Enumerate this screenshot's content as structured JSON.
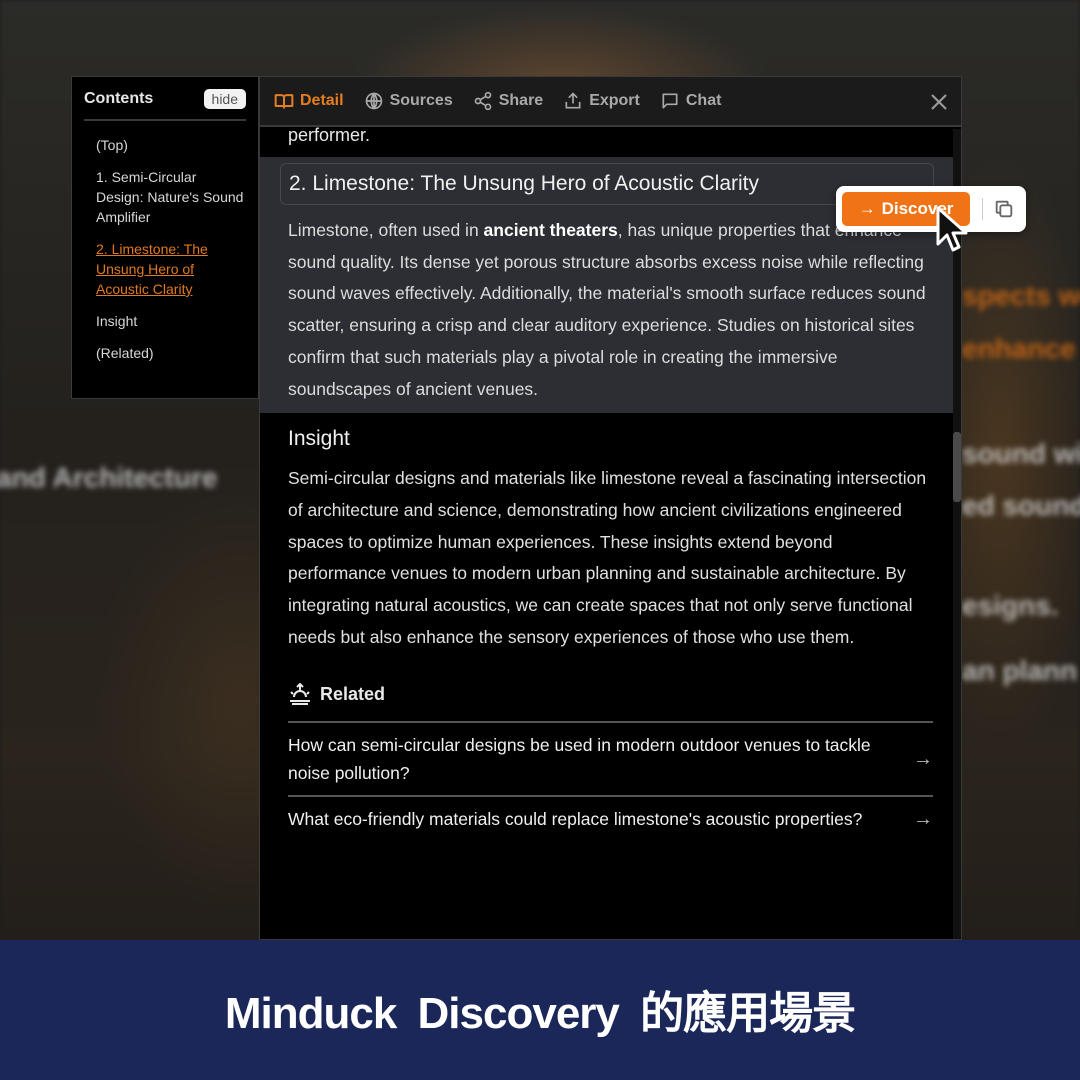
{
  "background": {
    "blurred_texts": [
      {
        "text": "and Architecture",
        "tone": "white"
      },
      {
        "text": "spects wo",
        "tone": "orange"
      },
      {
        "text": "enhance s",
        "tone": "orange"
      },
      {
        "text": "sound wit",
        "tone": "white"
      },
      {
        "text": "ed soundsc",
        "tone": "white"
      },
      {
        "text": "esigns.",
        "tone": "white"
      },
      {
        "text": "an plann",
        "tone": "white"
      }
    ]
  },
  "contents": {
    "title": "Contents",
    "hide_label": "hide",
    "items": [
      {
        "label": "(Top)",
        "active": false
      },
      {
        "label": "1. Semi-Circular Design: Nature's Sound Amplifier",
        "active": false
      },
      {
        "label": "2. Limestone: The Unsung Hero of Acoustic Clarity",
        "active": true
      },
      {
        "label": "Insight",
        "active": false
      },
      {
        "label": "(Related)",
        "active": false
      }
    ]
  },
  "tabs": [
    {
      "label": "Detail",
      "icon": "book-open-icon",
      "active": true
    },
    {
      "label": "Sources",
      "icon": "globe-icon",
      "active": false
    },
    {
      "label": "Share",
      "icon": "share-icon",
      "active": false
    },
    {
      "label": "Export",
      "icon": "export-icon",
      "active": false
    },
    {
      "label": "Chat",
      "icon": "chat-icon",
      "active": false
    }
  ],
  "article": {
    "previous_tail": "performer.",
    "section": {
      "heading": "2. Limestone: The Unsung Hero of Acoustic Clarity",
      "body_pre": "Limestone, often used in ",
      "body_bold": "ancient theaters",
      "body_post": ", has unique properties that enhance sound quality. Its dense yet porous structure absorbs excess noise while reflecting sound waves effectively. Additionally, the material's smooth surface reduces sound scatter, ensuring a crisp and clear auditory experience. Studies on historical sites confirm that such materials play a pivotal role in creating the immersive soundscapes of ancient venues."
    },
    "insight": {
      "title": "Insight",
      "body": "Semi-circular designs and materials like limestone reveal a fascinating intersection of architecture and science, demonstrating how ancient civilizations engineered spaces to optimize human experiences. These insights extend beyond performance venues to modern urban planning and sustainable architecture. By integrating natural acoustics, we can create spaces that not only serve functional needs but also enhance the sensory experiences of those who use them."
    },
    "related": {
      "title": "Related",
      "items": [
        {
          "question": "How can semi-circular designs be used in modern outdoor venues to tackle noise pollution?"
        },
        {
          "question": "What eco-friendly materials could replace limestone's acoustic properties?"
        }
      ]
    }
  },
  "popup": {
    "discover_label": "Discover",
    "accent": "#f07416"
  },
  "banner": {
    "text": "Minduck Discovery 的應用場景",
    "background": "#1b2759"
  },
  "colors": {
    "active_tab": "#e57d22",
    "active_toc": "#e07a1f"
  }
}
